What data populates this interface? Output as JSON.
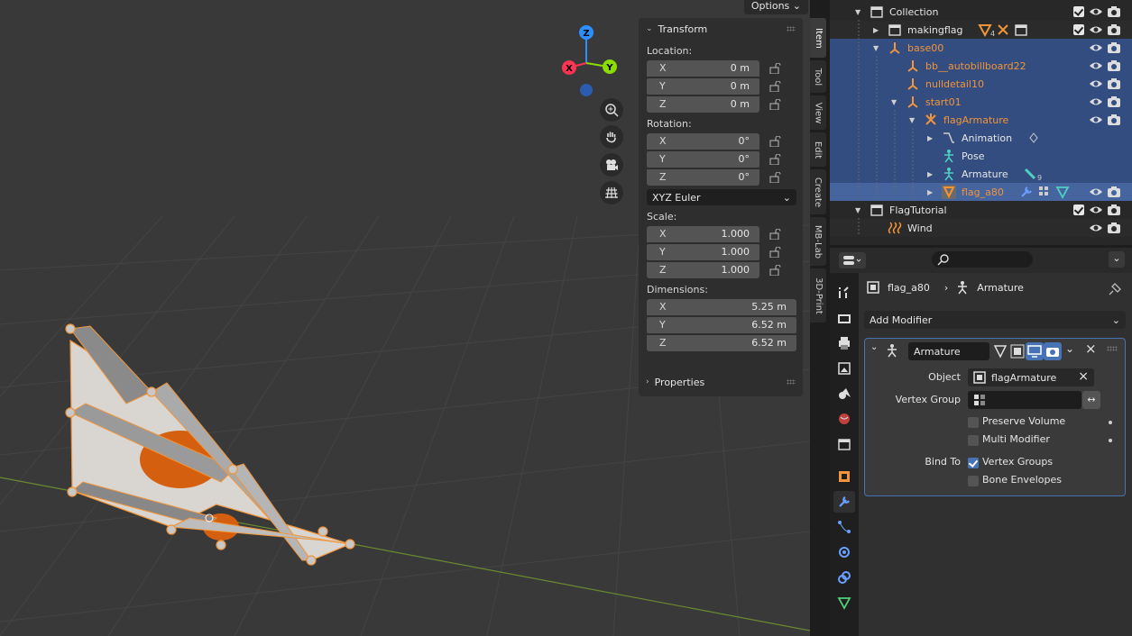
{
  "viewport": {
    "options_label": "Options",
    "gizmo": {
      "z": "Z",
      "x": "X",
      "y": "Y"
    },
    "nav_icons": [
      "zoom-icon",
      "hand-pan-icon",
      "camera-icon",
      "grid-icon"
    ]
  },
  "npanel": {
    "transform_title": "Transform",
    "location_label": "Location:",
    "location": [
      {
        "axis": "X",
        "value": "0 m"
      },
      {
        "axis": "Y",
        "value": "0 m"
      },
      {
        "axis": "Z",
        "value": "0 m"
      }
    ],
    "rotation_label": "Rotation:",
    "rotation": [
      {
        "axis": "X",
        "value": "0°"
      },
      {
        "axis": "Y",
        "value": "0°"
      },
      {
        "axis": "Z",
        "value": "0°"
      }
    ],
    "rotation_mode": "XYZ Euler",
    "scale_label": "Scale:",
    "scale": [
      {
        "axis": "X",
        "value": "1.000"
      },
      {
        "axis": "Y",
        "value": "1.000"
      },
      {
        "axis": "Z",
        "value": "1.000"
      }
    ],
    "dimensions_label": "Dimensions:",
    "dimensions": [
      {
        "axis": "X",
        "value": "5.25 m"
      },
      {
        "axis": "Y",
        "value": "6.52 m"
      },
      {
        "axis": "Z",
        "value": "6.52 m"
      }
    ],
    "properties_title": "Properties"
  },
  "sidetabs": [
    "Item",
    "Tool",
    "View",
    "Edit",
    "Create",
    "MB-Lab",
    "3D-Print"
  ],
  "outliner": {
    "rows": [
      {
        "label": "Collection"
      },
      {
        "label": "makingflag",
        "badge": "4"
      },
      {
        "label": "base00"
      },
      {
        "label": "bb__autobillboard22"
      },
      {
        "label": "nulldetail10"
      },
      {
        "label": "start01"
      },
      {
        "label": "flagArmature"
      },
      {
        "label": "Animation"
      },
      {
        "label": "Pose"
      },
      {
        "label": "Armature",
        "badge": "9"
      },
      {
        "label": "flag_a80"
      },
      {
        "label": "FlagTutorial"
      },
      {
        "label": "Wind"
      }
    ]
  },
  "properties": {
    "breadcrumb_object": "flag_a80",
    "breadcrumb_data": "Armature",
    "add_modifier": "Add Modifier",
    "modifier": {
      "name": "Armature",
      "object_label": "Object",
      "object_value": "flagArmature",
      "vertex_group_label": "Vertex Group",
      "preserve_volume": "Preserve Volume",
      "multi_modifier": "Multi Modifier",
      "bind_to_label": "Bind To",
      "vertex_groups": "Vertex Groups",
      "bone_envelopes": "Bone Envelopes"
    }
  },
  "colors": {
    "selection": "#334d80",
    "active_row": "#46649e",
    "accent": "#4772b3",
    "object_orange": "#f0953a"
  }
}
